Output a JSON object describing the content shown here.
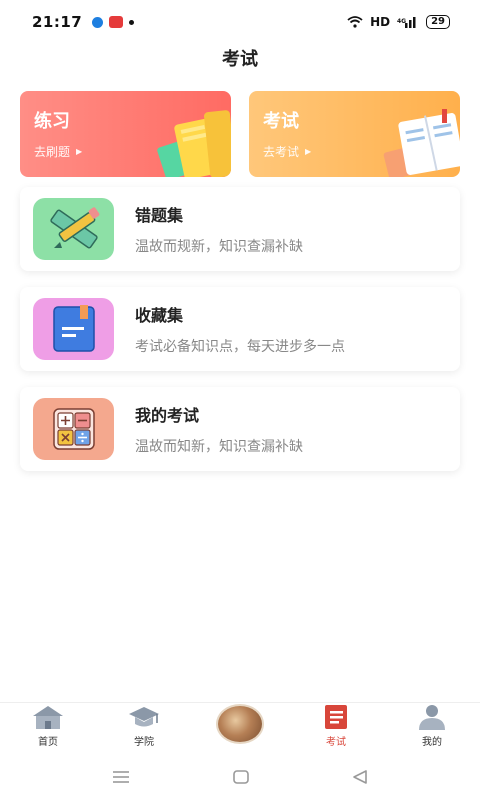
{
  "status": {
    "time": "21:17",
    "network": "HD",
    "battery": "29"
  },
  "header": {
    "title": "考试"
  },
  "top_cards": [
    {
      "title": "练习",
      "subtitle": "去刷题"
    },
    {
      "title": "考试",
      "subtitle": "去考试"
    }
  ],
  "list": [
    {
      "title": "错题集",
      "desc": "温故而规新，知识查漏补缺",
      "icon_bg": "#8de0a6"
    },
    {
      "title": "收藏集",
      "desc": "考试必备知识点，每天进步多一点",
      "icon_bg": "#ef9ee6"
    },
    {
      "title": "我的考试",
      "desc": "温故而知新，知识查漏补缺",
      "icon_bg": "#f4a88e"
    }
  ],
  "tabs": [
    {
      "label": "首页",
      "icon": "home-icon"
    },
    {
      "label": "学院",
      "icon": "graduation-cap-icon"
    },
    {
      "label": "",
      "icon": "avatar"
    },
    {
      "label": "考试",
      "icon": "exam-book-icon",
      "active": true
    },
    {
      "label": "我的",
      "icon": "profile-icon"
    }
  ],
  "colors": {
    "practice": "#ff6b63",
    "exam": "#ffb04c",
    "active_tab": "#d8463a"
  }
}
